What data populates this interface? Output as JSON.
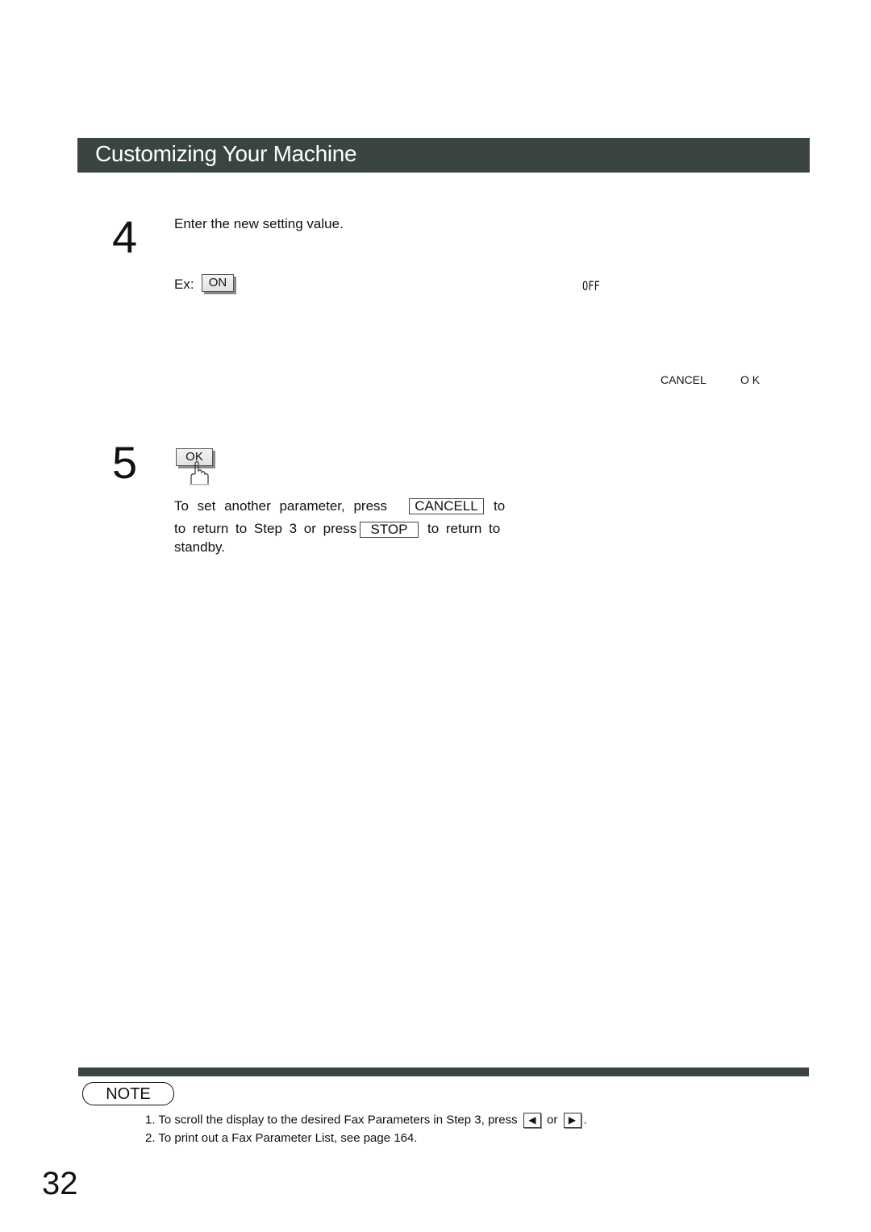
{
  "header": {
    "title": "Customizing Your Machine"
  },
  "step4": {
    "number": "4",
    "instruction": "Enter the new setting value.",
    "example_label": "Ex:",
    "example_key": "ON",
    "display": {
      "value": "OFF",
      "soft_left": "CANCEL",
      "soft_right": "O K"
    }
  },
  "step5": {
    "number": "5",
    "key": "OK",
    "icon": "finger-press-icon",
    "text_parts": {
      "p1": "To set another parameter, press",
      "key_cancel": "CANCELL",
      "p2": "to return to Step 3 or press",
      "key_stop": "STOP",
      "p3": "to return to standby."
    }
  },
  "note": {
    "badge": "NOTE",
    "items": [
      {
        "num": "1.",
        "text": "To scroll the display to the desired Fax Parameters in Step 3, press",
        "key_left": "◀",
        "joiner": "or",
        "key_right": "▶",
        "end": "."
      },
      {
        "num": "2.",
        "text": "To print out a Fax Parameter List, see page 164."
      }
    ]
  },
  "page_number": "32",
  "colors": {
    "header_bar": "#3a4443",
    "header_text": "#ffffff"
  }
}
